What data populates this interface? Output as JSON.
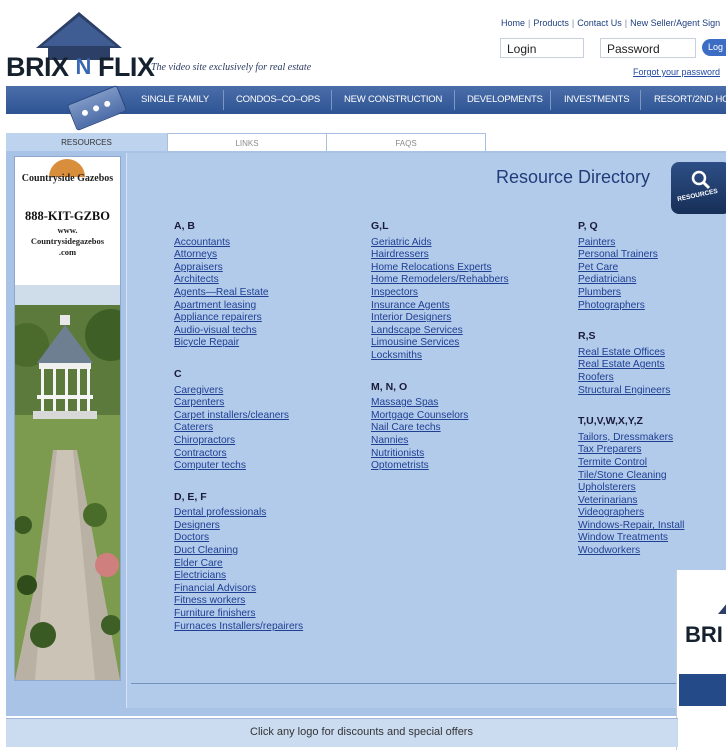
{
  "brand": {
    "name_part1": "BRIX",
    "name_part2": "N",
    "name_part3": "FLIX",
    "tagline": "The video site exclusively for real estate"
  },
  "top_links": [
    "Home",
    "Products",
    "Contact Us",
    "New Seller/Agent Sign"
  ],
  "login": {
    "login_placeholder": "Login",
    "password_placeholder": "Password",
    "button_label": "Log",
    "forgot_label": "Forgot your password"
  },
  "nav": [
    "SINGLE FAMILY",
    "CONDOS–CO–OPS",
    "NEW CONSTRUCTION",
    "DEVELOPMENTS",
    "INVESTMENTS",
    "RESORT/2ND HO"
  ],
  "tabs": [
    "RESOURCES",
    "LINKS",
    "FAQS"
  ],
  "ad": {
    "title": "Countryside Gazebos",
    "phone": "888-KIT-GZBO",
    "url_line1": "www.",
    "url_line2": "Countrysidegazebos",
    "url_line3": ".com"
  },
  "directory": {
    "title": "Resource Directory",
    "badge": "RESOURCES",
    "columns": [
      [
        {
          "heading": "A, B",
          "items": [
            "Accountants",
            "Attorneys",
            "Appraisers",
            "Architects",
            "Agents—Real Estate",
            "Apartment leasing",
            "Appliance repairers",
            "Audio-visual techs",
            "Bicycle Repair"
          ]
        },
        {
          "heading": "C",
          "items": [
            "Caregivers",
            "Carpenters",
            "Carpet installers/cleaners",
            "Caterers",
            "Chiropractors",
            "Contractors",
            "Computer techs"
          ]
        },
        {
          "heading": "D, E, F",
          "items": [
            "Dental professionals",
            "Designers",
            "Doctors",
            "Duct Cleaning",
            "Elder Care",
            "Electricians",
            "Financial Advisors",
            "Fitness workers",
            "Furniture finishers",
            "Furnaces Installers/repairers"
          ]
        }
      ],
      [
        {
          "heading": "G,L",
          "items": [
            "Geriatric Aids",
            "Hairdressers",
            "Home Relocations Experts",
            "Home Remodelers/Rehabbers",
            "Inspectors",
            "Insurance Agents",
            "Interior Designers",
            "Landscape Services",
            "Limousine Services",
            "Locksmiths"
          ]
        },
        {
          "heading": "M, N, O",
          "items": [
            "Massage Spas",
            "Mortgage Counselors",
            "Nail Care techs",
            "Nannies",
            "Nutritionists",
            "Optometrists"
          ]
        }
      ],
      [
        {
          "heading": "P, Q",
          "items": [
            "Painters",
            "Personal Trainers",
            "Pet Care",
            "Pediatricians",
            "Plumbers",
            "Photographers"
          ]
        },
        {
          "heading": "R,S",
          "items": [
            "Real Estate Offices",
            "Real Estate Agents",
            "Roofers",
            "Structural Engineers"
          ]
        },
        {
          "heading": "T,U,V,W,X,Y,Z",
          "items": [
            "Tailors, Dressmakers",
            "Tax Preparers",
            "Termite Control",
            "Tile/Stone Cleaning",
            "Upholsterers",
            "Veterinarians",
            "Videographers",
            "Windows-Repair, Install",
            "Window Treatments",
            "Woodworkers"
          ]
        }
      ]
    ]
  },
  "footer": {
    "text": "Click any logo for discounts and special offers"
  },
  "corner_card": {
    "word": "BRI"
  },
  "colors": {
    "nav": "#3a5f9f",
    "panel": "#b3cbea",
    "link": "#1f3f93",
    "title": "#203d7a"
  }
}
